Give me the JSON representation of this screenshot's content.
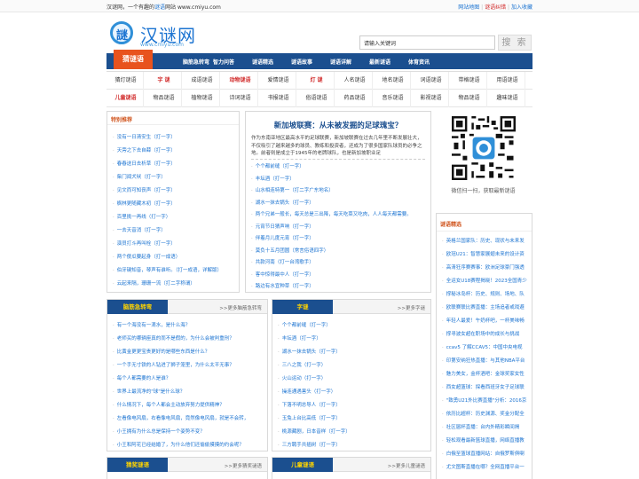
{
  "topbar": {
    "left_prefix": "汉谜网，一个有趣的",
    "left_highlight": "谜语",
    "left_suffix": "网站 www.cmiyu.com",
    "sitemap": "网站地图",
    "feedback": "谜语纠错",
    "favorite": "加入收藏"
  },
  "header": {
    "logo_glyph": "謎",
    "logo_text": "汉谜网",
    "logo_sub": "www.cmiyu.com",
    "search_placeholder": "请输入关键词",
    "search_button": "搜 索"
  },
  "nav": {
    "active": "猜谜语",
    "items": [
      "脑筋急转弯",
      "智力问答",
      "谜语精选",
      "谜语故事",
      "谜语详解",
      "最新谜语",
      "体育资讯"
    ]
  },
  "categories": {
    "row1": [
      "猜灯谜语",
      "字 谜",
      "成语谜语",
      "动物谜语",
      "爱情谜语",
      "灯 谜",
      "人名谜语",
      "地名谜语",
      "词语谜语",
      "带格谜语",
      "用语谜语"
    ],
    "row2": [
      "儿童谜语",
      "物品谜语",
      "植物谜语",
      "诗词谜语",
      "书报谜语",
      "俗语谜语",
      "药品谜语",
      "音乐谜语",
      "影视谜语",
      "物品谜语",
      "趣味谜语"
    ]
  },
  "featured": {
    "title": "特别推荐",
    "items": [
      "没有一日清安生（打一字）",
      "天旁之下去自薛（打一字）",
      "春春送日去析草（打一字）",
      "柴门闻犬吠（打一字）",
      "见文而可知丧声（打一字）",
      "枫林更随藏木初（打一字）",
      "百里挑一再线（打一字）",
      "一去天音消（打一字）",
      "演员打斗再叫栓（打一字）",
      "两个傻瓜要起身（打一成语）",
      "伯牙键知音，琴声有谁听。（打一成语，详解版）",
      "云起来隔，珊珊一流（打二字称谓）"
    ]
  },
  "article": {
    "title": "新加坡联赛：从未被发掘的足球瑰宝？",
    "body": "作为东南亚地区最高水平的足球联赛，新加坡联赛在过去几年里不断发展壮大，不仅吸引了越来越多的球员、教练和投资者，还成为了很多国家队球员的必争之地。前者则是成立于1945年的老牌球队，也是新加坡职业足",
    "items": [
      "个个都前缝（打一字）",
      "丰坛酒（打一字）",
      "山水相连特第一（打二字广东地名）",
      "湖水一抹去锅头（打一字）",
      "两个兄弟一般长，每天总是三出降，每天吃菜又吃肉，人人每天都需要。",
      "元宵节日猜声响（打一字）",
      "伴着月儿度元宵（打一字）",
      "莫负十五月团圆（常言俗语四字）",
      "共款河南（打一台湾歌手）",
      "客中惊得最中人（打一字）",
      "路边有水宜种草（打一字）"
    ]
  },
  "qr": {
    "caption": "微信扫一扫，获取最新谜语"
  },
  "news": {
    "title": "谜语精选",
    "items": [
      "英格兰国家队：历史、现状与未来发",
      "欧冠U21：智慧家展翅未来的设计资",
      "高清狂序赛赛事：欧洲足球豪门强透",
      "全运女U18赛程揭晓！2023全国青少",
      "撑秘冰岛杯：历史、规则、场地、队",
      "欧联赛联比赛直播：主场追者或戏避",
      "年轻人最爱！午奶杯吧，一杯美味畅",
      "撑寻波女超在职场中的成长与挑战",
      "ccav5 了解CCAV5：中国中央电视",
      "印第安纳狂热直播：与其他NBA平台",
      "魅力美女，金杯酒吧：金球奖家女性",
      "西女超篮球：探看西班牙女子足球联",
      "\"致勇U21外比赛直播\"分析：2016京",
      "依历比超杯：历史渊源、奖金分配全",
      "社区届杯直播：台内外精彩瞬间揭",
      "轻松观看最新篮球直播，网络直播教",
      "白俄至篮球直播网站：自俄罗斯俱喇",
      "尤文图斯直播在哪？全网直播平台一"
    ]
  },
  "brain": {
    "tag": "脑筋急转弯",
    "more": ">>更多脑筋急转弯",
    "items": [
      "有一个海没有一滴水，是什么海？",
      "老师买的哪辆座真的而不是假的，为什么会被判重刑？",
      "比黄金更更宝贵更好的是哪些东西是什么？",
      "一个手无寸铁的人钻进了狮子笼里，为什么太平无事？",
      "每个人都需要的人是谁？",
      "世界上最流净的\"球\"是什么球？",
      "什么情况下，每个人都会主动放弃努力提供精神？",
      "左看像电风扇，右看像电风扇，竟然像电风扇，就是不会转，",
      "小王拥有为什么总是保持一个姿势不变？",
      "小王和阿花已经结婚了，为什么他们还偷偷摸摸的约会呢？"
    ]
  },
  "zimi": {
    "tag": "字谜",
    "more": ">>更多字谜",
    "items": [
      "个个都前缝（打一字）",
      "丰坛酒（打一字）",
      "湖水一抹去锅头（打一字）",
      "三八之我（打一字）",
      "火山运动（打一字）",
      "操连通遇害头（打一字）",
      "下落不明总导人（打一字）",
      "玉兔上台比高低（打一字）",
      "桃源藏剧，日本音样（打一字）",
      "三方聘手共插树（打一字）"
    ]
  },
  "bottom": {
    "left_tag": "猜奖谜语",
    "left_more": ">>更多猜奖谜语",
    "right_tag": "儿童谜语",
    "right_more": ">>更多儿童谜语"
  }
}
